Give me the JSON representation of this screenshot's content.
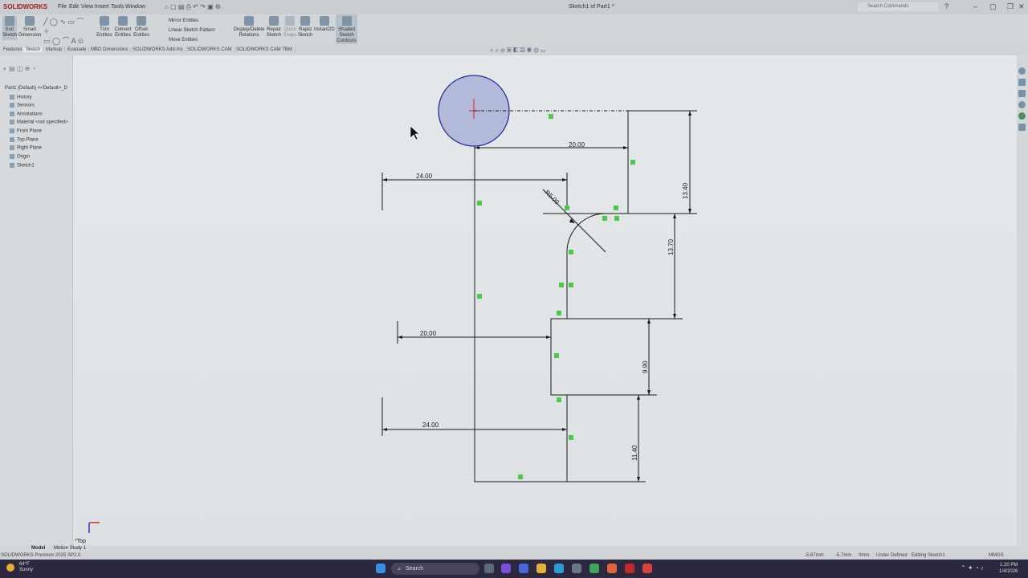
{
  "app": {
    "logo": "SOLIDWORKS",
    "menus": [
      "File",
      "Edit",
      "View",
      "Insert",
      "Tools",
      "Window"
    ],
    "doc_title": "Sketch1 of Part1 *",
    "search_placeholder": "Search Commands"
  },
  "toolbar": {
    "exit_sketch": "Exit Sketch",
    "smart_dimension": "Smart Dimension",
    "trim_entities": "Trim Entities",
    "convert_entities": "Convert Entities",
    "offset_entities": "Offset Entities",
    "mirror_entities": "Mirror Entities",
    "linear_pattern": "Linear Sketch Pattern",
    "move_entities": "Move Entities",
    "display_delete_relations": "Display/Delete Relations",
    "repair_sketch": "Repair Sketch",
    "quick_snaps": "Quick Snaps",
    "rapid_sketch": "Rapid Sketch",
    "instant2d": "Instant2D",
    "shaded_contours": "Shaded Sketch Contours"
  },
  "tabs": [
    "Features",
    "Sketch",
    "Markup",
    "Evaluate",
    "MBD Dimensions",
    "SOLIDWORKS Add-Ins",
    "SOLIDWORKS CAM",
    "SOLIDWORKS CAM TBM"
  ],
  "active_tab": "Sketch",
  "tree": {
    "root": "Part1 (Default) <<Default>_D",
    "items": [
      "History",
      "Sensors",
      "Annotations",
      "Material <not specified>",
      "Front Plane",
      "Top Plane",
      "Right Plane",
      "Origin",
      "Sketch1"
    ]
  },
  "dimensions": {
    "d_20_top": "20.00",
    "d_24_top": "24.00",
    "radius": "R5.00",
    "d_13_40": "13.40",
    "d_13_70": "13.70",
    "d_20_mid": "20.00",
    "d_9_90": "9.90",
    "d_24_bottom": "24.00",
    "d_11_40": "11.40"
  },
  "view_label": "*Top",
  "bottom_tabs": [
    "Model",
    "Motion Study 1"
  ],
  "status": {
    "product": "SOLIDWORKS Premium 2025 SP2.0",
    "x": "-5.87mm",
    "y": "-5.7mm",
    "z": "0mm",
    "state": "Under Defined",
    "editing": "Editing Sketch1",
    "units": "MMGS"
  },
  "taskbar": {
    "weather_temp": "64°F",
    "weather_desc": "Sunny",
    "search": "Search",
    "time": "1:20 PM",
    "date": "1/4/2026"
  },
  "colors": {
    "circle_fill": "#a6afd4",
    "circle_stroke": "#2a2fa8",
    "relation_green": "#4cc84c"
  }
}
